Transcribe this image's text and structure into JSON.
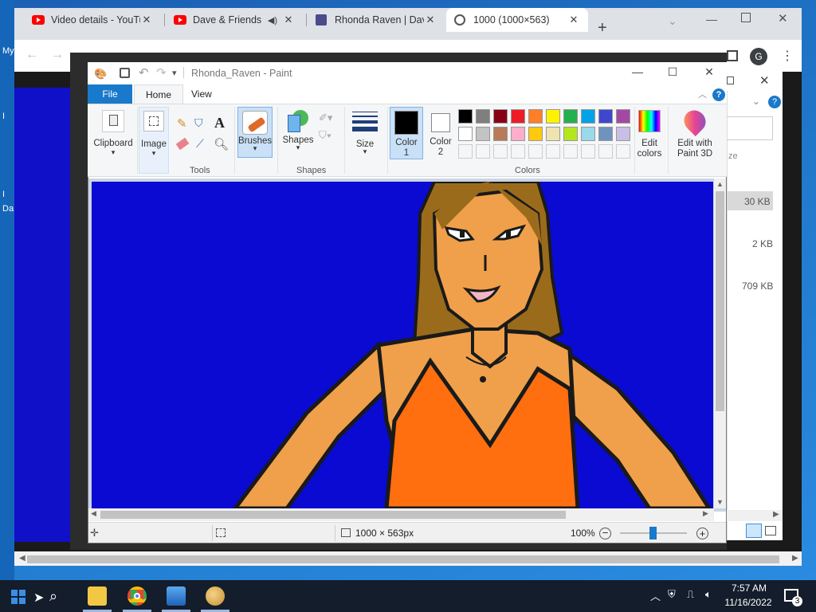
{
  "desktop": {
    "labels": [
      "My",
      "I",
      "I",
      "Da"
    ]
  },
  "browser": {
    "tabs": [
      {
        "title": "Video details - YouTu",
        "icon": "youtube-icon"
      },
      {
        "title": "Dave & Friends T",
        "icon": "youtube-icon"
      },
      {
        "title": "Rhonda Raven | Dave",
        "icon": "deviantart-icon"
      },
      {
        "title": "1000 (1000×563)",
        "icon": "globe-icon"
      }
    ],
    "new_tab": "+",
    "profile_initial": "G"
  },
  "explorer": {
    "sizes": [
      "30 KB",
      "2 KB",
      "709 KB"
    ],
    "partial_text": "ze"
  },
  "paint": {
    "title": "Rhonda_Raven - Paint",
    "tabs": {
      "file": "File",
      "home": "Home",
      "view": "View"
    },
    "ribbon": {
      "clipboard": "Clipboard",
      "image": "Image",
      "tools": "Tools",
      "brushes": "Brushes",
      "shapes_btn": "Shapes",
      "shapes_group": "Shapes",
      "size": "Size",
      "color1": "Color\n1",
      "color1_a": "Color",
      "color1_b": "1",
      "color2_a": "Color",
      "color2_b": "2",
      "edit_colors_a": "Edit",
      "edit_colors_b": "colors",
      "edit3d_a": "Edit with",
      "edit3d_b": "Paint 3D",
      "colors_group": "Colors",
      "text_tool": "A"
    },
    "palette_row1": [
      "#000000",
      "#7f7f7f",
      "#880015",
      "#ed1c24",
      "#ff7f27",
      "#fff200",
      "#22b14c",
      "#00a2e8",
      "#3f48cc",
      "#a349a4"
    ],
    "palette_row2": [
      "#ffffff",
      "#c3c3c3",
      "#b97a57",
      "#ffaec9",
      "#ffc90e",
      "#efe4b0",
      "#b5e61d",
      "#99d9ea",
      "#7092be",
      "#c8bfe7"
    ],
    "status": {
      "dimensions": "1000 × 563px",
      "zoom": "100%"
    }
  },
  "taskbar": {
    "time": "7:57 AM",
    "date": "11/16/2022",
    "notifications": "3"
  }
}
